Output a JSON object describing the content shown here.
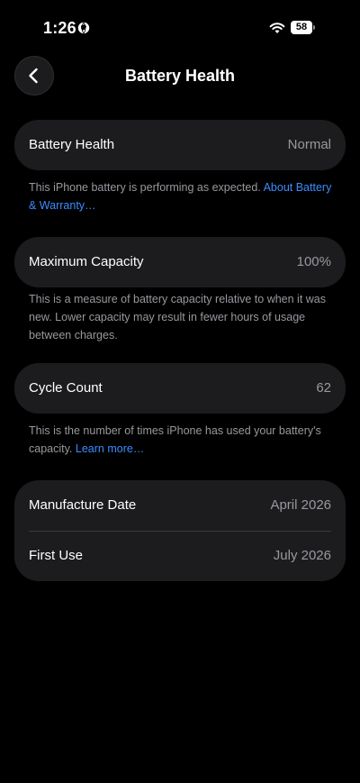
{
  "status_bar": {
    "time": "1:26",
    "battery_level": "58",
    "icons": [
      "location-globe-icon",
      "wifi-icon",
      "battery-icon"
    ]
  },
  "nav": {
    "title": "Battery Health",
    "back_icon": "chevron-left-icon"
  },
  "health": {
    "label": "Battery Health",
    "value": "Normal",
    "footnote_text": "This iPhone battery is performing as expected.",
    "footnote_link": "About Battery & Warranty…"
  },
  "capacity": {
    "label": "Maximum Capacity",
    "value": "100%",
    "footnote_text": "This is a measure of battery capacity relative to when it was new. Lower capacity may result in fewer hours of usage between charges."
  },
  "cycles": {
    "label": "Cycle Count",
    "value": "62",
    "footnote_text": "This is the number of times iPhone has used your battery's capacity.",
    "footnote_link": "Learn more…"
  },
  "dates": {
    "manufacture_label": "Manufacture Date",
    "manufacture_value": "April 2026",
    "first_use_label": "First Use",
    "first_use_value": "July 2026"
  },
  "colors": {
    "background": "#000000",
    "card": "#1c1c1e",
    "secondary_text": "#98989f",
    "link": "#3a8cff"
  }
}
